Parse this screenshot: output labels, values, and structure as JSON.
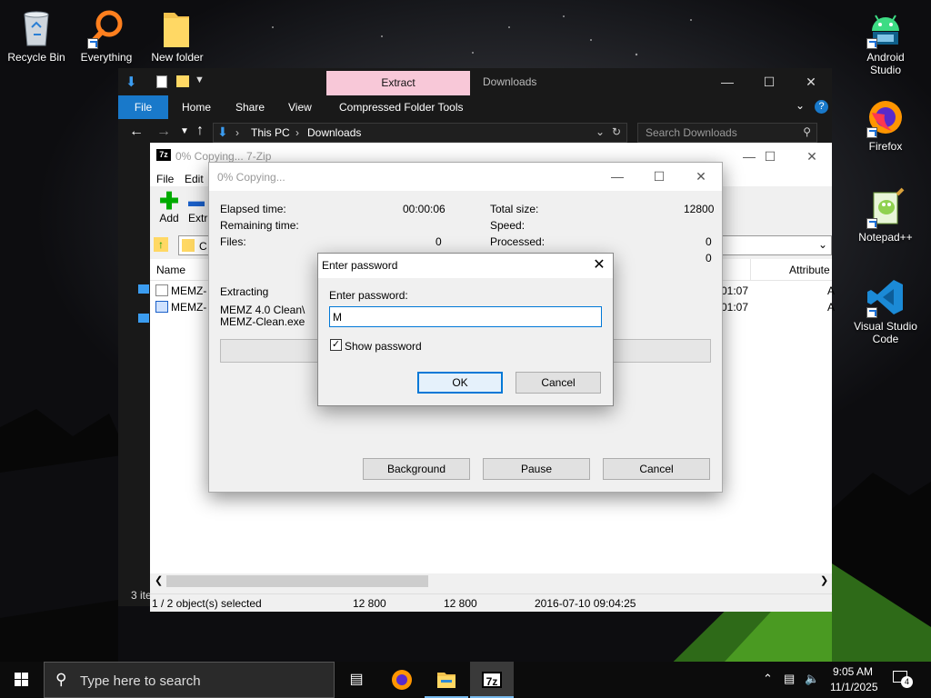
{
  "desktop": {
    "left_icons": [
      {
        "name": "recycle-bin-icon",
        "label": "Recycle Bin"
      },
      {
        "name": "everything-icon",
        "label": "Everything"
      },
      {
        "name": "new-folder-icon",
        "label": "New folder"
      }
    ],
    "right_icons": [
      {
        "name": "android-studio-icon",
        "label": "Android Studio"
      },
      {
        "name": "firefox-icon",
        "label": "Firefox"
      },
      {
        "name": "notepad-plus-plus-icon",
        "label": "Notepad++"
      },
      {
        "name": "visual-studio-code-icon",
        "label": "Visual Studio Code"
      }
    ]
  },
  "explorer": {
    "context_tab": "Extract",
    "title": "Downloads",
    "ribbon": {
      "file": "File",
      "home": "Home",
      "share": "Share",
      "view": "View",
      "compressed_tools": "Compressed Folder Tools"
    },
    "breadcrumb": [
      "This PC",
      "Downloads"
    ],
    "search_placeholder": "Search Downloads",
    "status_left": "3 ite"
  },
  "zip_window": {
    "title": "0% Copying... 7-Zip",
    "menu": [
      "File",
      "Edit"
    ],
    "toolbar": {
      "add": "Add",
      "extract": "Extr"
    },
    "path_fragment": "C",
    "columns": {
      "name": "Name",
      "attributes": "Attribute"
    },
    "rows": [
      {
        "name": "MEMZ-",
        "time": "01:07",
        "attr": "A"
      },
      {
        "name": "MEMZ-",
        "time": "01:07",
        "attr": "A"
      }
    ],
    "status": {
      "selected": "1 / 2 object(s) selected",
      "size": "12 800",
      "packed": "12 800",
      "modified": "2016-07-10 09:04:25"
    }
  },
  "progress_dialog": {
    "title": "0% Copying...",
    "labels": {
      "elapsed": "Elapsed time:",
      "remaining": "Remaining time:",
      "files": "Files:",
      "total_size": "Total size:",
      "speed": "Speed:",
      "processed": "Processed:"
    },
    "values": {
      "elapsed": "00:00:06",
      "files": "0",
      "total_size": "12800",
      "processed": "0",
      "hidden_row": "0"
    },
    "action": "Extracting",
    "file_path": [
      "MEMZ 4.0 Clean\\",
      "MEMZ-Clean.exe"
    ],
    "progress_value": 0,
    "buttons": {
      "background": "Background",
      "pause": "Pause",
      "cancel": "Cancel"
    }
  },
  "password_dialog": {
    "title": "Enter password",
    "label": "Enter password:",
    "value": "M",
    "show_password_label": "Show password",
    "show_password_checked": true,
    "ok": "OK",
    "cancel": "Cancel"
  },
  "taskbar": {
    "search_placeholder": "Type here to search",
    "time": "9:05 AM",
    "date": "11/1/2025",
    "notification_count": "4"
  },
  "colors": {
    "accent_blue": "#1979ca",
    "context_tab_pink": "#f8c8d8",
    "focus_blue": "#0078d7"
  }
}
